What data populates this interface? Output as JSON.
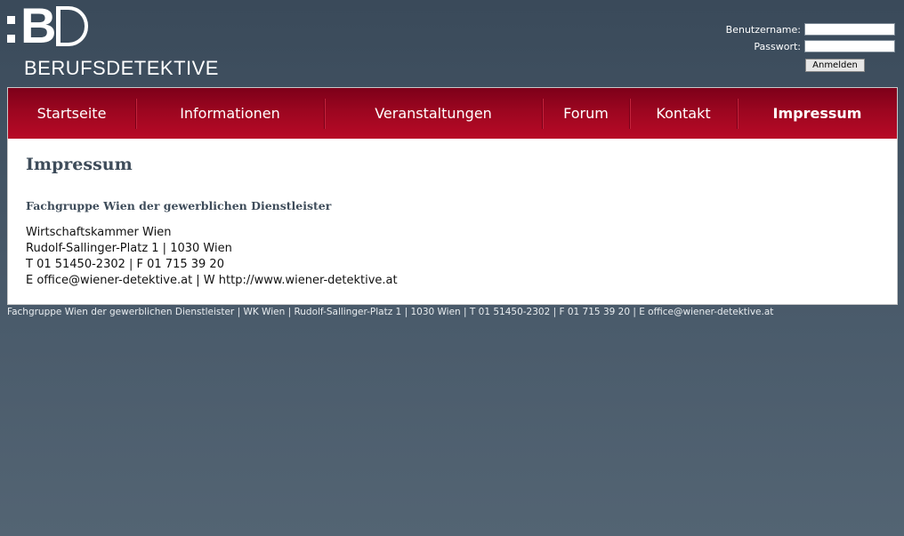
{
  "logo": {
    "mark_letter_b": "B",
    "subtitle": "BERUFSDETEKTIVE"
  },
  "login": {
    "username_label": "Benutzername:",
    "username_value": "",
    "password_label": "Passwort:",
    "password_value": "",
    "submit_label": "Anmelden"
  },
  "nav": {
    "items": [
      {
        "label": "Startseite"
      },
      {
        "label": "Informationen"
      },
      {
        "label": "Veranstaltungen"
      },
      {
        "label": "Forum"
      },
      {
        "label": "Kontakt"
      },
      {
        "label": "Impressum"
      }
    ],
    "active": "Impressum"
  },
  "content": {
    "title": "Impressum",
    "org_title": "Fachgruppe Wien der gewerblichen Dienstleister",
    "lines": [
      "Wirtschaftskammer Wien",
      "Rudolf-Sallinger-Platz 1 | 1030 Wien",
      "T 01 51450-2302 | F 01 715 39 20",
      "E office@wiener-detektive.at | W http://www.wiener-detektive.at"
    ]
  },
  "footer": {
    "text": "Fachgruppe Wien der gewerblichen Dienstleister | WK Wien | Rudolf-Sallinger-Platz 1 | 1030 Wien | T 01 51450-2302 | F 01 715 39 20 | E office@wiener-detektive.at"
  },
  "colors": {
    "background": "#3a4a5a",
    "nav_red": "#9c0620",
    "heading": "#3e4c5a"
  }
}
